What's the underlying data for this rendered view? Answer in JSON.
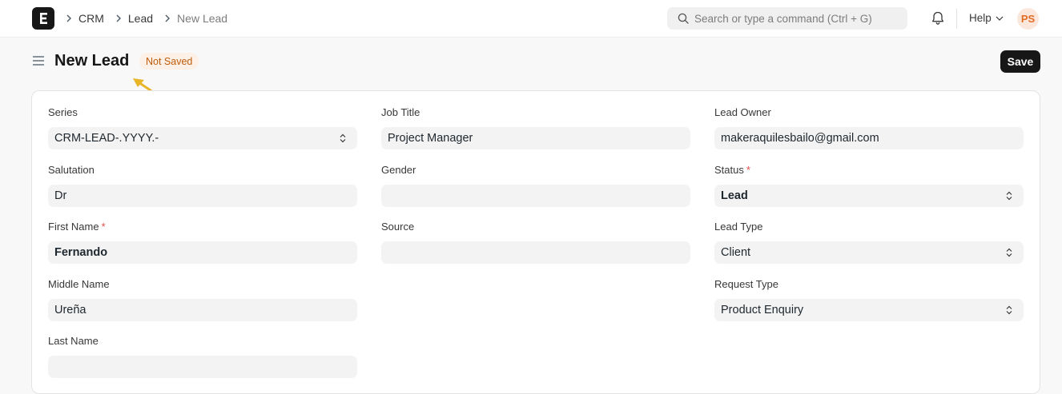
{
  "breadcrumbs": [
    "CRM",
    "Lead",
    "New Lead"
  ],
  "search": {
    "placeholder": "Search or type a command (Ctrl + G)"
  },
  "header": {
    "help_label": "Help",
    "avatar_initials": "PS"
  },
  "page": {
    "title": "New Lead",
    "status_badge": "Not Saved",
    "save_label": "Save"
  },
  "form": {
    "series": {
      "label": "Series",
      "value": "CRM-LEAD-.YYYY.-"
    },
    "salutation": {
      "label": "Salutation",
      "value": "Dr"
    },
    "first_name": {
      "label": "First Name",
      "value": "Fernando",
      "required": "*"
    },
    "middle_name": {
      "label": "Middle Name",
      "value": "Ureña"
    },
    "last_name": {
      "label": "Last Name",
      "value": ""
    },
    "job_title": {
      "label": "Job Title",
      "value": "Project Manager"
    },
    "gender": {
      "label": "Gender",
      "value": ""
    },
    "source": {
      "label": "Source",
      "value": ""
    },
    "lead_owner": {
      "label": "Lead Owner",
      "value": "makeraquilesbailo@gmail.com"
    },
    "status": {
      "label": "Status",
      "value": "Lead",
      "required": "*"
    },
    "lead_type": {
      "label": "Lead Type",
      "value": "Client"
    },
    "request_type": {
      "label": "Request Type",
      "value": "Product Enquiry"
    }
  },
  "colors": {
    "accent": "#171717",
    "badge_bg": "#fdf0e6",
    "badge_text": "#bd5b0b",
    "required": "#e24c4c",
    "avatar_text": "#e26d24",
    "arrow": "#e8b528"
  }
}
